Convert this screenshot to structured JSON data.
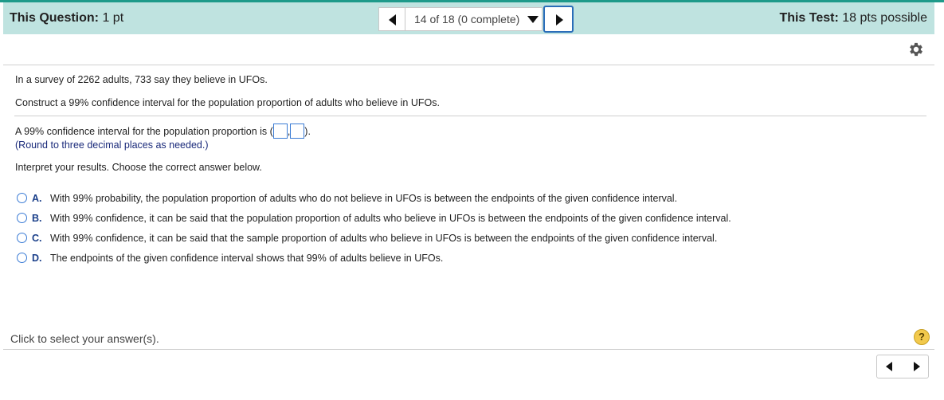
{
  "header": {
    "question_label": "This Question:",
    "question_points": "1 pt",
    "nav_select": "14 of 18 (0 complete)",
    "test_label": "This Test:",
    "test_points": "18 pts possible",
    "accent_color": "#bfe3e0"
  },
  "question": {
    "line1": "In a survey of 2262 adults, 733 say they believe in UFOs.",
    "line2": "Construct a 99% confidence interval for the population proportion of adults who believe in UFOs.",
    "interval_prefix": "A 99% confidence interval for the population proportion is (",
    "interval_sep": ",",
    "interval_suffix": ").",
    "hint": "(Round to three decimal places as needed.)",
    "interpret": "Interpret your results. Choose the correct answer below."
  },
  "choices": [
    {
      "letter": "A.",
      "text": "With 99% probability, the population proportion of adults who do not believe in UFOs is between the endpoints of the given confidence interval."
    },
    {
      "letter": "B.",
      "text": "With 99% confidence, it can be said that the population proportion of adults who believe in UFOs is between the endpoints of the given confidence interval."
    },
    {
      "letter": "C.",
      "text": "With 99% confidence, it can be said that the sample proportion of adults who believe in UFOs is between the endpoints of the given confidence interval."
    },
    {
      "letter": "D.",
      "text": "The endpoints of the given confidence interval shows that 99% of adults believe in UFOs."
    }
  ],
  "footer": {
    "status": "Click to select your answer(s).",
    "help_symbol": "?"
  },
  "icons": {
    "settings": "gear-icon",
    "help": "help-icon",
    "prev": "triangle-left-icon",
    "next": "triangle-right-icon",
    "dropdown": "caret-down-icon"
  }
}
